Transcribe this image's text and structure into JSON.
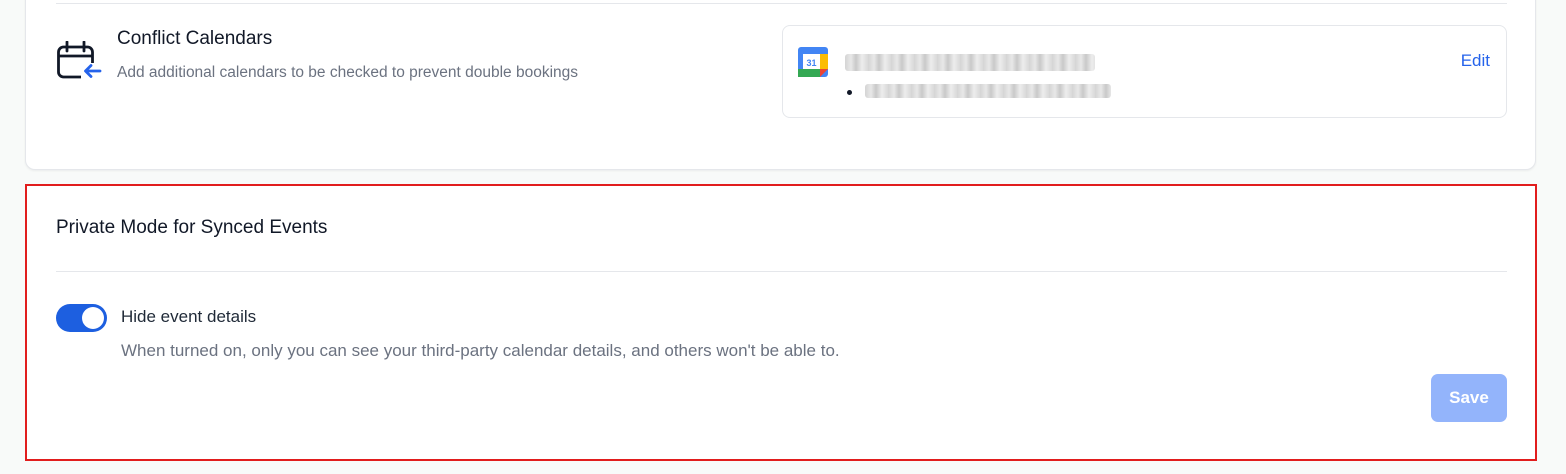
{
  "conflict_calendars": {
    "title": "Conflict Calendars",
    "description": "Add additional calendars to be checked to prevent double bookings",
    "calendar_icon": "calendar-arrow-icon",
    "calendar_entry": {
      "provider_icon": "google-calendar-icon",
      "provider_icon_text": "31"
    },
    "edit_label": "Edit"
  },
  "private_mode": {
    "title": "Private Mode for Synced Events",
    "toggle": {
      "label": "Hide event details",
      "checked": true,
      "help_text": "When turned on, only you can see your third-party calendar details, and others won't be able to."
    },
    "save_label": "Save",
    "save_enabled": false
  },
  "colors": {
    "accent": "#1d5fe0",
    "link": "#2563eb",
    "highlight_border": "#e11d1d",
    "save_disabled": "#93b4fb"
  }
}
